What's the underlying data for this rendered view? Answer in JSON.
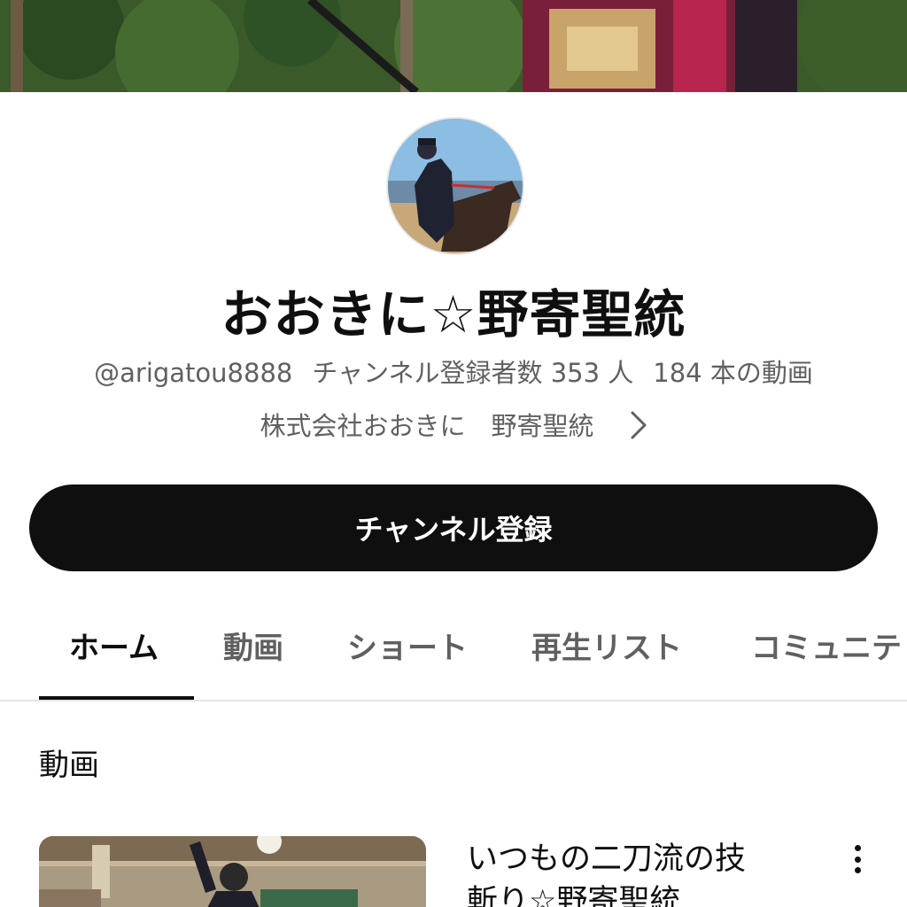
{
  "channel": {
    "name": "おおきに☆野寄聖統",
    "handle": "@arigatou8888",
    "subscribers": "チャンネル登録者数 353 人",
    "videos": "184 本の動画",
    "link_text": "株式会社おおきに　野寄聖統"
  },
  "subscribe_label": "チャンネル登録",
  "tabs": [
    {
      "label": "ホーム",
      "active": true
    },
    {
      "label": "動画"
    },
    {
      "label": "ショート"
    },
    {
      "label": "再生リスト"
    },
    {
      "label": "コミュニテ"
    }
  ],
  "section": {
    "title": "動画"
  },
  "video": {
    "title_line1": "いつもの二刀流の技",
    "title_line2": "斬り☆野寄聖統"
  },
  "icons": {
    "chevron": "chevron-right-icon",
    "menu": "more-vert-icon"
  },
  "colors": {
    "text_primary": "#0f0f0f",
    "text_secondary": "#606060",
    "subscribe_bg": "#0f0f0f",
    "divider": "#e5e5e5"
  }
}
